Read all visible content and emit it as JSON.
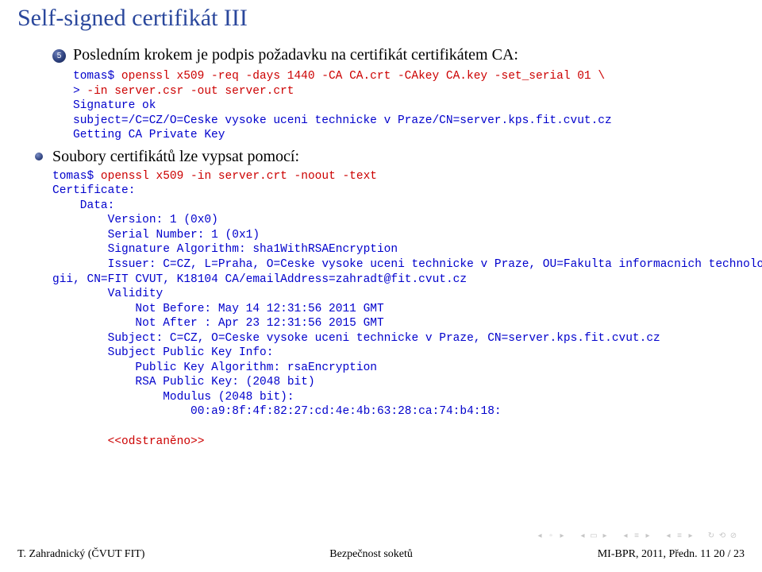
{
  "title": "Self-signed certifikát III",
  "step": {
    "num": "5",
    "text": "Posledním krokem je podpis požadavku na certifikát certifikátem CA:"
  },
  "bullet": {
    "text": "Soubory certifikátů lze vypsat pomocí:"
  },
  "block1": {
    "l1a": "tomas$ ",
    "l1b": "openssl x509 -req -days 1440 -CA CA.crt -CAkey CA.key -set_serial 01 \\",
    "l2a": "> ",
    "l2b": "-in server.csr -out server.crt",
    "l3": "Signature ok",
    "l4": "subject=/C=CZ/O=Ceske vysoke uceni technicke v Praze/CN=server.kps.fit.cvut.cz",
    "l5": "Getting CA Private Key"
  },
  "block2": {
    "l1a": "tomas$ ",
    "l1b": "openssl x509 -in server.crt -noout -text",
    "l2": "Certificate:",
    "l3": "    Data:",
    "l4": "        Version: 1 (0x0)",
    "l5": "        Serial Number: 1 (0x1)",
    "l6": "        Signature Algorithm: sha1WithRSAEncryption",
    "l7": "        Issuer: C=CZ, L=Praha, O=Ceske vysoke uceni technicke v Praze, OU=Fakulta informacnich technolo",
    "l8": "gii, CN=FIT CVUT, K18104 CA/emailAddress=zahradt@fit.cvut.cz",
    "l9": "        Validity",
    "l10": "            Not Before: May 14 12:31:56 2011 GMT",
    "l11": "            Not After : Apr 23 12:31:56 2015 GMT",
    "l12": "        Subject: C=CZ, O=Ceske vysoke uceni technicke v Praze, CN=server.kps.fit.cvut.cz",
    "l13": "        Subject Public Key Info:",
    "l14": "            Public Key Algorithm: rsaEncryption",
    "l15": "            RSA Public Key: (2048 bit)",
    "l16": "                Modulus (2048 bit):",
    "l17": "                    00:a9:8f:4f:82:27:cd:4e:4b:63:28:ca:74:b4:18:",
    "end": "        <<odstraněno>>"
  },
  "footer": {
    "left": "T. Zahradnický (ČVUT FIT)",
    "center": "Bezpečnost soketů",
    "right": "MI-BPR, 2011, Předn. 11    20 / 23"
  }
}
